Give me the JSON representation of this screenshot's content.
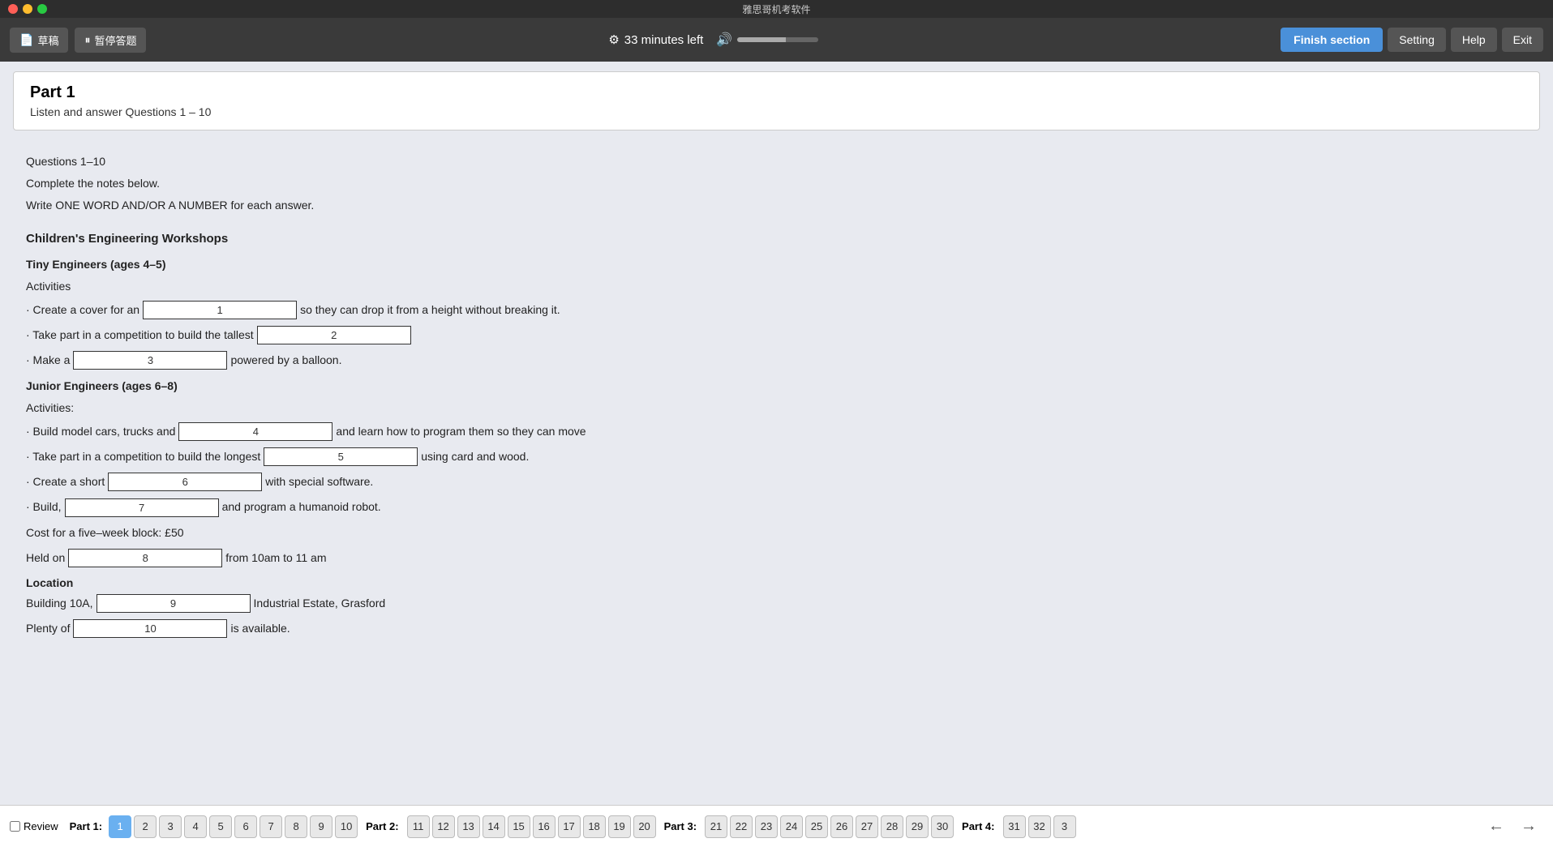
{
  "titleBar": {
    "appName": "雅思哥机考软件"
  },
  "topNav": {
    "draftBtn": "草稿",
    "pauseBtn": "暂停答题",
    "timerIcon": "⚙",
    "timerText": "33 minutes left",
    "finishBtn": "Finish section",
    "settingBtn": "Setting",
    "helpBtn": "Help",
    "exitBtn": "Exit"
  },
  "section": {
    "title": "Part 1",
    "subtitle": "Listen and answer Questions 1 – 10"
  },
  "instructions": {
    "line1": "Questions 1–10",
    "line2": "Complete the notes below.",
    "line3": "Write ONE WORD AND/OR A NUMBER for each answer."
  },
  "workshopTitle": "Children's Engineering Workshops",
  "tinyEngineers": {
    "heading": "Tiny Engineers (ages 4–5)",
    "activitiesLabel": "Activities",
    "items": [
      {
        "prefix": "· Create a cover for an",
        "inputId": "1",
        "inputValue": "1",
        "suffix": "so they can drop it from a height without breaking it."
      },
      {
        "prefix": "· Take part in a competition to build the tallest",
        "inputId": "2",
        "inputValue": "2",
        "suffix": ""
      },
      {
        "prefix": "· Make a",
        "inputId": "3",
        "inputValue": "3",
        "suffix": "powered by a balloon."
      }
    ]
  },
  "juniorEngineers": {
    "heading": "Junior Engineers (ages 6–8)",
    "activitiesLabel": "Activities:",
    "items": [
      {
        "prefix": "· Build model cars, trucks and",
        "inputId": "4",
        "inputValue": "4",
        "suffix": "and learn how to program them so they can move"
      },
      {
        "prefix": "· Take part in a competition to build the longest",
        "inputId": "5",
        "inputValue": "5",
        "suffix": "using card and wood."
      },
      {
        "prefix": "· Create a short",
        "inputId": "6",
        "inputValue": "6",
        "suffix": "with special software."
      },
      {
        "prefix": "· Build,",
        "inputId": "7",
        "inputValue": "7",
        "suffix": "and program a humanoid robot."
      }
    ]
  },
  "cost": "Cost for a five–week block: £50",
  "heldOn": {
    "prefix": "Held on",
    "inputId": "8",
    "inputValue": "8",
    "suffix": "from 10am to 11 am"
  },
  "location": {
    "heading": "Location",
    "building": {
      "prefix": "Building 10A,",
      "inputId": "9",
      "inputValue": "9",
      "suffix": "Industrial Estate, Grasford"
    },
    "parking": {
      "prefix": "Plenty of",
      "inputId": "10",
      "inputValue": "10",
      "suffix": "is available."
    }
  },
  "bottomNav": {
    "reviewLabel": "Review",
    "part1Label": "Part 1:",
    "part2Label": "Part 2:",
    "part3Label": "Part 3:",
    "part4Label": "Part 4:",
    "part1Pages": [
      "1",
      "2",
      "3",
      "4",
      "5",
      "6",
      "7",
      "8",
      "9",
      "10"
    ],
    "part2Pages": [
      "11",
      "12",
      "13",
      "14",
      "15",
      "16",
      "17",
      "18",
      "19",
      "20"
    ],
    "part3Pages": [
      "21",
      "22",
      "23",
      "24",
      "25",
      "26",
      "27",
      "28",
      "29",
      "30"
    ],
    "part4Pages": [
      "31",
      "32",
      "3"
    ],
    "activePage": "1",
    "prevArrow": "←",
    "nextArrow": "→"
  },
  "colors": {
    "accent": "#4a90d9",
    "activePageBg": "#6ab0f0"
  }
}
